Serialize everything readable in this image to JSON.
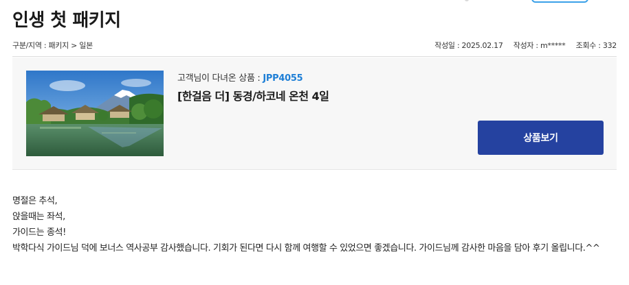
{
  "page": {
    "title": "인생 첫 패키지"
  },
  "meta": {
    "breadcrumb": "구분/지역 : 패키지 > 일본",
    "date": "작성일 : 2025.02.17",
    "author": "작성자 : m*****",
    "views": "조회수 : 332"
  },
  "product": {
    "code_label": "고객님이 다녀온 상품 : ",
    "code": "JPP4055",
    "name": "[한걸음 더] 동경/하코네 온천 4일",
    "view_button": "상품보기"
  },
  "review": {
    "lines": [
      "명절은 추석,",
      "앉을때는 좌석,",
      "가이드는 종석!",
      "박학다식 가이드님 덕에 보너스 역사공부 감사했습니다. 기회가 된다면 다시 함께 여행할 수 있었으면 좋겠습니다. 가이드님께 감사한 마음을 담아 후기 올립니다.^^"
    ]
  },
  "colors": {
    "accent_blue": "#1e7fd6",
    "button_bg": "#2542a0",
    "box_bg": "#f7f7f7"
  }
}
